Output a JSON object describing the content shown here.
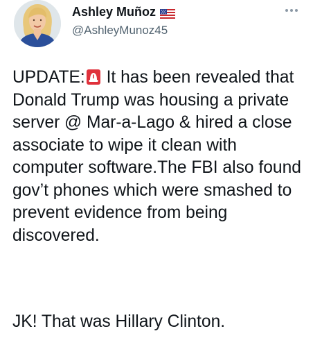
{
  "author": {
    "display_name": "Ashley Muñoz",
    "handle": "@AshleyMunoz45",
    "flag_icon": "us-flag-icon",
    "avatar_icon": "profile-photo"
  },
  "tweet": {
    "prefix": "UPDATE:",
    "emoji_icon": "police-car-light-icon",
    "text_after_emoji": " It has been revealed that Donald Trump was housing a private server @ Mar-a-Lago & hired a close associate to wipe it clean with computer software.The FBI also found gov’t phones which were smashed to prevent evidence from being discovered.",
    "punchline": "JK! That was Hillary Clinton."
  },
  "colors": {
    "text": "#0f1419",
    "secondary": "#536471",
    "more_dots": "#8b98a5",
    "siren_red": "#e0313b"
  }
}
